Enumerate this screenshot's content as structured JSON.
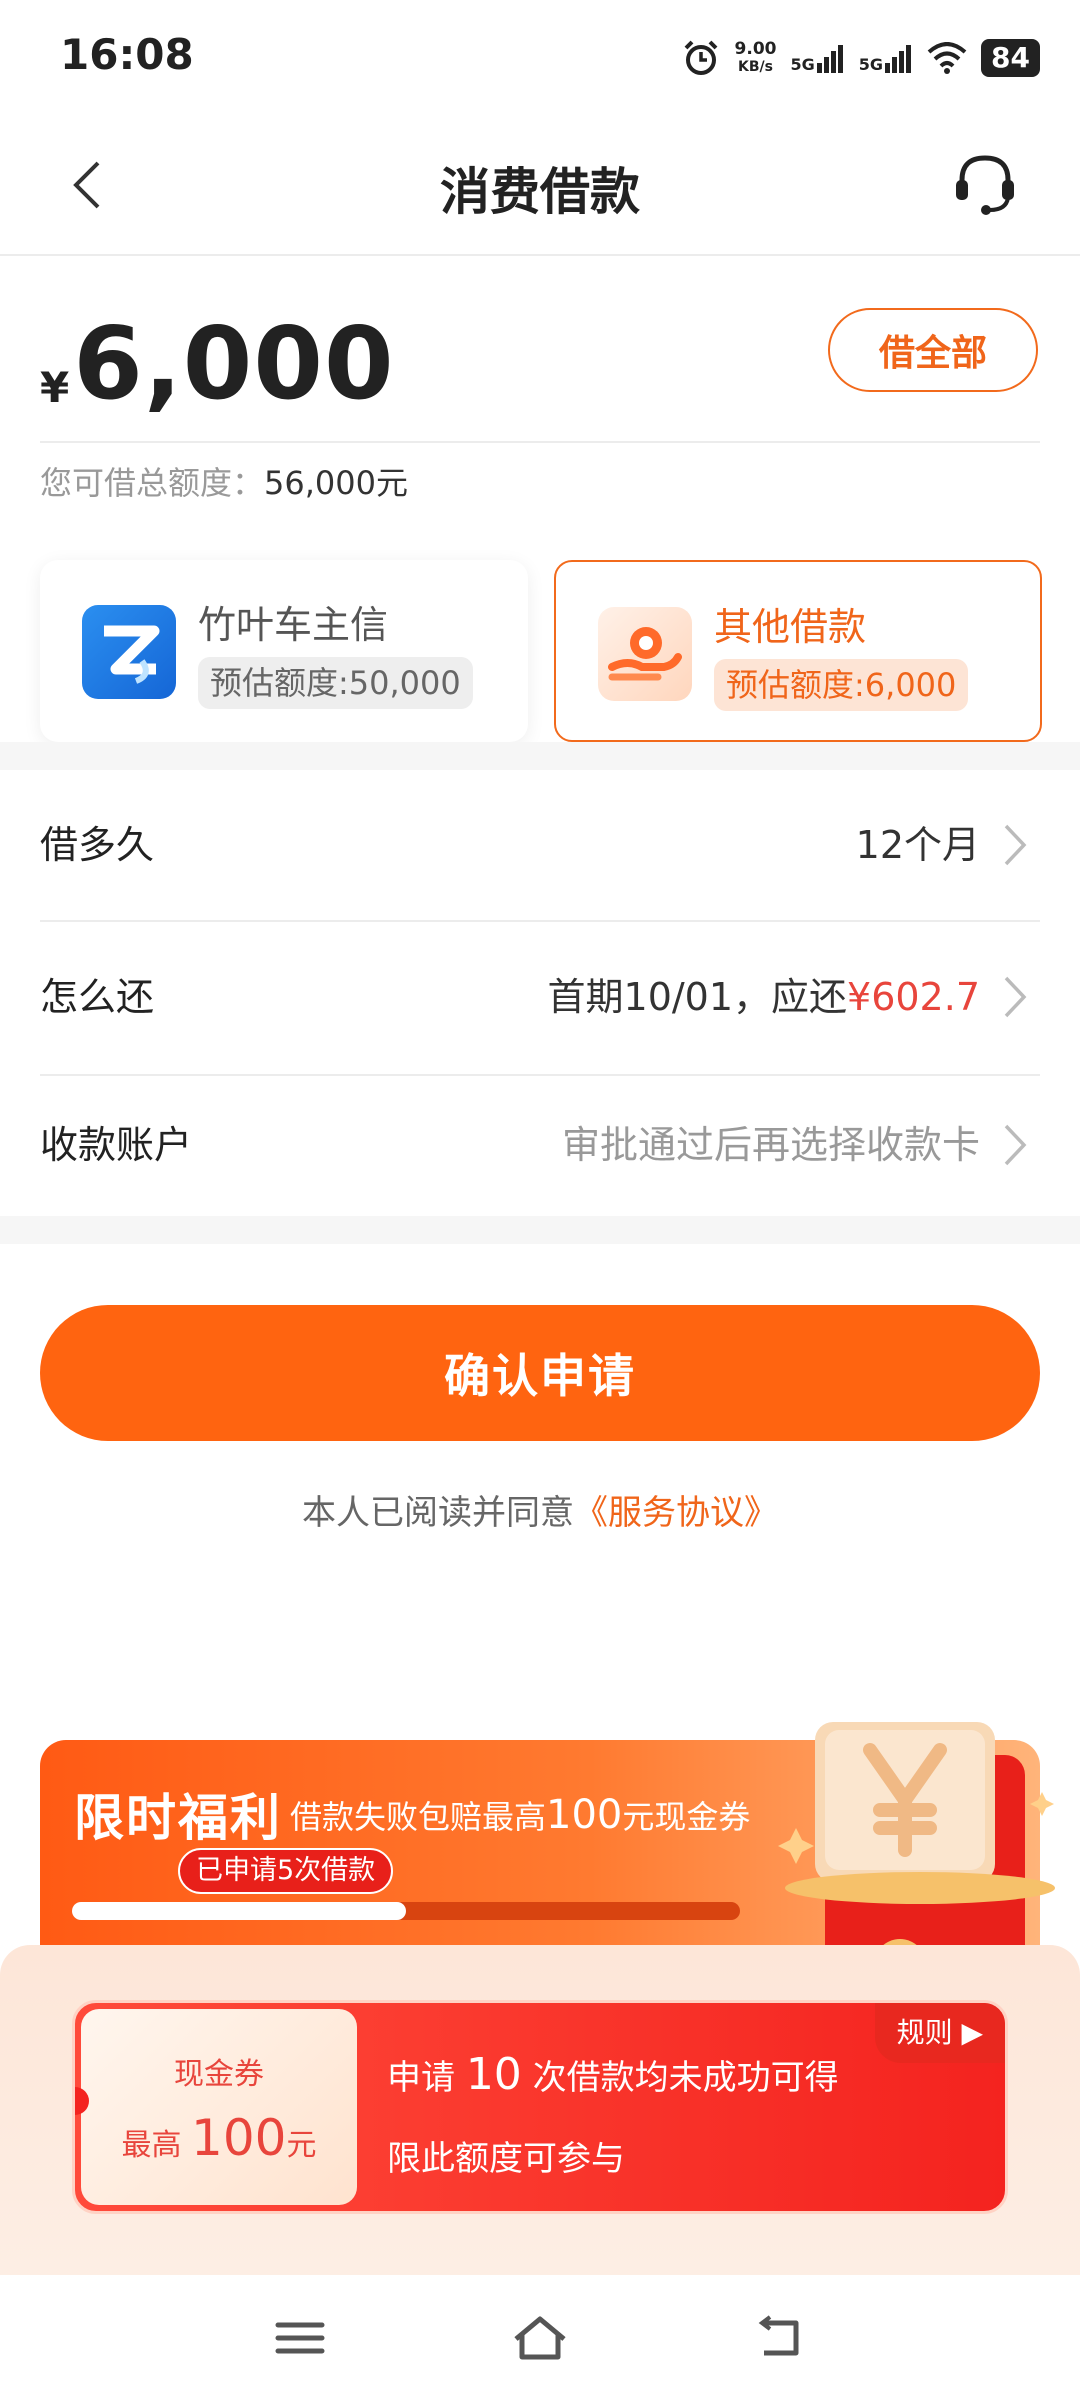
{
  "status_bar": {
    "time": "16:08",
    "net_speed": "9.00",
    "net_unit": "KB/s",
    "signal1": "5G",
    "signal2": "5G",
    "battery": "84"
  },
  "header": {
    "title": "消费借款"
  },
  "loan": {
    "currency": "¥",
    "amount": "6,000",
    "borrow_all_label": "借全部",
    "total_limit_label": "您可借总额度：",
    "total_limit_value": "56,000元"
  },
  "products": [
    {
      "name": "竹叶车主信",
      "limit": "预估额度:50,000"
    },
    {
      "name": "其他借款",
      "limit": "预估额度:6,000"
    }
  ],
  "rows": {
    "term": {
      "label": "借多久",
      "value": "12个月"
    },
    "repay": {
      "label": "怎么还",
      "value_prefix": "首期10/01，应还",
      "value_amount": "¥602.7"
    },
    "account": {
      "label": "收款账户",
      "value": "审批通过后再选择收款卡"
    }
  },
  "confirm_label": "确认申请",
  "agreement": {
    "text": "本人已阅读并同意",
    "link": "《服务协议》"
  },
  "promo": {
    "title": "限时福利",
    "subtitle_pre": "借款失败包赔最高",
    "subtitle_num": "100",
    "subtitle_post": "元现金券",
    "progress_tag": "已申请5次借款",
    "progress": 0.5
  },
  "coupon": {
    "stub_label": "现金券",
    "stub_prefix": "最高",
    "stub_amount": "100",
    "stub_unit": "元",
    "line1_pre": "申请",
    "line1_num": "10",
    "line1_post": "次借款均未成功可得",
    "line2": "限此额度可参与",
    "rules_label": "规则 ▶"
  },
  "colors": {
    "accent": "#ff6410",
    "accent_text": "#f0651a",
    "red": "#e8453c"
  }
}
